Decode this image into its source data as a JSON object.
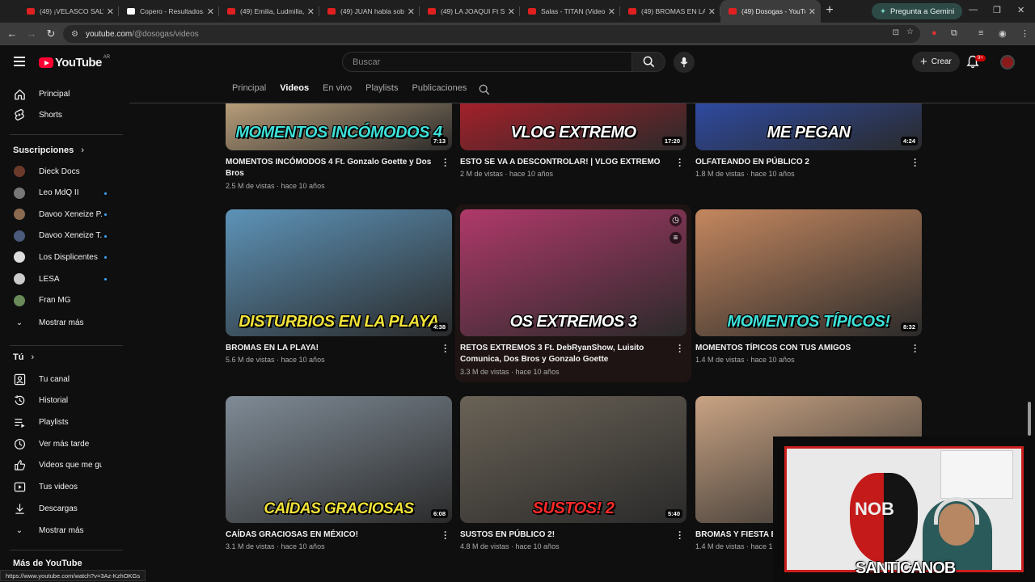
{
  "browser": {
    "tabs": [
      {
        "title": "(49) ¡VELASCO SALVO...",
        "icon": "youtube-favicon"
      },
      {
        "title": "Copero - Resultados...",
        "icon": "generic-favicon"
      },
      {
        "title": "(49) Emilia, Ludmilla,...",
        "icon": "youtube-favicon"
      },
      {
        "title": "(49) JUAN habla sobre...",
        "icon": "youtube-favicon"
      },
      {
        "title": "(49) LA JOAQUI Ft Sal...",
        "icon": "youtube-favicon"
      },
      {
        "title": "Salas - TITAN (Video...",
        "icon": "youtube-favicon"
      },
      {
        "title": "(49) BROMAS EN LA...",
        "icon": "youtube-favicon"
      },
      {
        "title": "(49) Dosogas - YouTu...",
        "icon": "youtube-favicon",
        "active": true
      }
    ],
    "gemini_label": "Pregunta a Gemini",
    "url_host": "youtube.com",
    "url_path": "/@dosogas/videos",
    "status_url": "https://www.youtube.com/watch?v=3Az-KzhOKGs"
  },
  "header": {
    "logo_text": "YouTube",
    "country_code": "AR",
    "search_placeholder": "Buscar",
    "create_label": "Crear",
    "notifications_badge": "9+"
  },
  "sidebar": {
    "main": [
      {
        "label": "Principal",
        "icon": "home-icon"
      },
      {
        "label": "Shorts",
        "icon": "shorts-icon"
      }
    ],
    "subs_title": "Suscripciones",
    "subscriptions": [
      {
        "label": "Dieck Docs",
        "color": "#6b3a2a",
        "live": false
      },
      {
        "label": "Leo MdQ II",
        "color": "#777777",
        "live": true
      },
      {
        "label": "Davoo Xeneize P...",
        "color": "#8a6a50",
        "live": true
      },
      {
        "label": "Davoo Xeneize T...",
        "color": "#4a5a7a",
        "live": true
      },
      {
        "label": "Los Displicentes",
        "color": "#dddddd",
        "live": true
      },
      {
        "label": "LESA",
        "color": "#cccccc",
        "live": true
      },
      {
        "label": "Fran MG",
        "color": "#6a8a5a",
        "live": false
      }
    ],
    "show_more": "Mostrar más",
    "you_title": "Tú",
    "you_items": [
      {
        "label": "Tu canal",
        "icon": "user-icon"
      },
      {
        "label": "Historial",
        "icon": "history-icon"
      },
      {
        "label": "Playlists",
        "icon": "playlist-icon"
      },
      {
        "label": "Ver más tarde",
        "icon": "clock-icon"
      },
      {
        "label": "Videos que me gus...",
        "icon": "thumbs-up-icon"
      },
      {
        "label": "Tus videos",
        "icon": "video-icon"
      },
      {
        "label": "Descargas",
        "icon": "download-icon"
      }
    ],
    "show_more_2": "Mostrar más",
    "more_title": "Más de YouTube"
  },
  "channel_tabs": [
    "Principal",
    "Videos",
    "En vivo",
    "Playlists",
    "Publicaciones"
  ],
  "active_tab": "Videos",
  "videos": [
    {
      "title": "MOMENTOS INCÓMODOS  4 Ft. Gonzalo Goette y Dos Bros",
      "meta": "2.5 M de vistas · hace 10 años",
      "duration": "7:13",
      "caption": "MOMENTOS INCÓMODOS 4",
      "bg": "#b79d7a",
      "capcolor": "#3de1d8"
    },
    {
      "title": "ESTO SE VA A DESCONTROLAR! | VLOG EXTREMO",
      "meta": "2 M de vistas · hace 10 años",
      "duration": "17:20",
      "caption": "VLOG EXTREMO",
      "bg": "#a3202a",
      "capcolor": "#ffffff"
    },
    {
      "title": "OLFATEANDO EN PÚBLICO 2",
      "meta": "1.8 M de vistas · hace 10 años",
      "duration": "4:24",
      "caption": "ME PEGAN",
      "bg": "#2e4aa0",
      "capcolor": "#ffffff"
    },
    {
      "title": "BROMAS EN LA PLAYA!",
      "meta": "5.6 M de vistas · hace 10 años",
      "duration": "4:38",
      "caption": "DISTURBIOS EN LA PLAYA",
      "bg": "#5d93b8",
      "capcolor": "#f0e23a"
    },
    {
      "title": "RETOS EXTREMOS 3 Ft. DebRyanShow, Luisito Comunica, Dos Bros y Gonzalo Goette",
      "meta": "3.3 M de vistas · hace 10 años",
      "duration": "",
      "caption": "OS EXTREMOS 3",
      "bg": "#b0396a",
      "capcolor": "#ffffff"
    },
    {
      "title": "MOMENTOS TÍPICOS CON TUS AMIGOS",
      "meta": "1.4 M de vistas · hace 10 años",
      "duration": "8:32",
      "caption": "MOMENTOS TÍPICOS!",
      "bg": "#c4875f",
      "capcolor": "#3de1d8"
    },
    {
      "title": "CAÍDAS GRACIOSAS EN MÉXICO!",
      "meta": "3.1 M de vistas · hace 10 años",
      "duration": "6:08",
      "caption": "CAÍDAS GRACIOSAS",
      "bg": "#7f8b96",
      "capcolor": "#f0e23a"
    },
    {
      "title": "SUSTOS EN PÚBLICO 2!",
      "meta": "4.8 M de vistas · hace 10 años",
      "duration": "5:40",
      "caption": "SUSTOS! 2",
      "bg": "#6a6256",
      "capcolor": "#ff2a2a"
    },
    {
      "title": "BROMAS Y FIESTA E...",
      "meta": "1.4 M de vistas · hace 1...",
      "duration": "",
      "caption": "",
      "bg": "#c9a383",
      "capcolor": "#ffffff"
    }
  ],
  "webcam": {
    "streamer_name": "SANTICANOB",
    "shirt_text": "NOB"
  }
}
